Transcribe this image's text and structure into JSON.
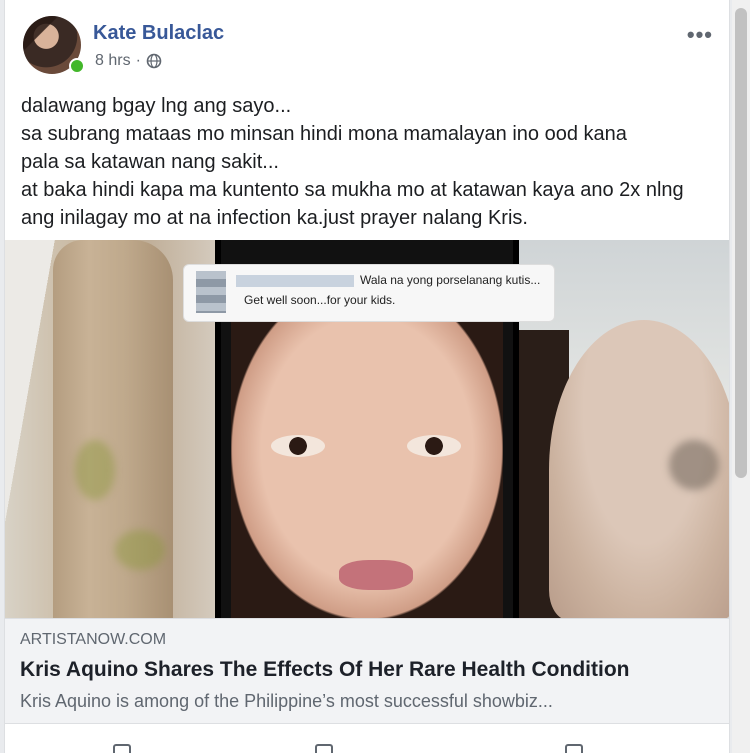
{
  "post": {
    "author": "Kate Bulaclac",
    "time": "8 hrs",
    "separator": "·",
    "privacy_icon": "globe-icon",
    "more_icon": "more-icon",
    "more_glyph": "•••",
    "text_lines": [
      "dalawang bgay lng ang sayo...",
      "sa subrang mataas mo minsan hindi mona mamalayan ino ood kana",
      "pala sa katawan nang sakit...",
      "at baka hindi kapa ma kuntento sa mukha mo at katawan kaya ano 2x nlng",
      "ang inilagay mo at na infection ka.just prayer nalang Kris."
    ]
  },
  "image": {
    "comment_line1": "Wala na yong porselanang kutis...",
    "comment_line2": "Get well soon...for your kids."
  },
  "link": {
    "domain": "ARTISTANOW.COM",
    "title": "Kris Aquino Shares The Effects Of Her Rare Health Condition",
    "description": "Kris Aquino is among of the Philippine’s most successful showbiz..."
  },
  "colors": {
    "author": "#385898",
    "online": "#42b72a",
    "link_bg": "#f2f3f5"
  }
}
